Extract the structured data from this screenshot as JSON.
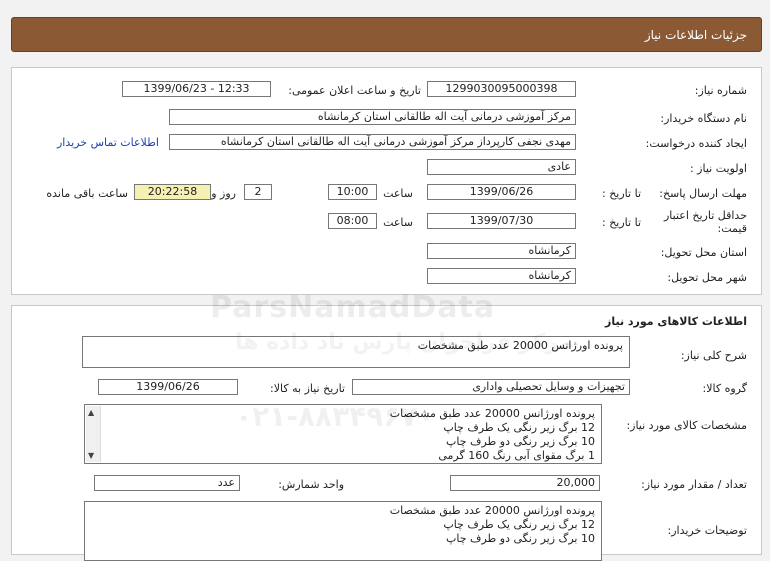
{
  "header": {
    "title": "جزئیات اطلاعات نیاز"
  },
  "form": {
    "need_number_label": "شماره نیاز:",
    "need_number": "1299030095000398",
    "announce_label": "تاریخ و ساعت اعلان عمومی:",
    "announce_value": "1399/06/23 - 12:33",
    "buyer_label": "نام دستگاه خریدار:",
    "buyer_value": "مرکز آموزشی درمانی آیت اله طالقانی استان کرمانشاه",
    "creator_label": "ایجاد کننده درخواست:",
    "creator_value": "مهدی نجفی کارپرداز مرکز آموزشی درمانی آیت اله طالقانی استان کرمانشاه",
    "contact_link": "اطلاعات تماس خریدار",
    "priority_label": "اولویت نیاز :",
    "priority_value": "عادی",
    "deadline_label": "مهلت ارسال پاسخ:",
    "to_date_label": "تا تاریخ :",
    "deadline_date": "1399/06/26",
    "time_label": "ساعت",
    "deadline_time": "10:00",
    "days_value": "2",
    "days_label": "روز و",
    "remaining_value": "20:22:58",
    "remaining_label": "ساعت باقی مانده",
    "validity_label_line1": "حداقل تاریخ اعتبار",
    "validity_label_line2": "قیمت:",
    "validity_to_label": "تا تاریخ :",
    "validity_date": "1399/07/30",
    "validity_time_label": "ساعت",
    "validity_time": "08:00",
    "province_label": "استان محل تحویل:",
    "province_value": "کرمانشاه",
    "city_label": "شهر محل تحویل:",
    "city_value": "کرمانشاه"
  },
  "goods": {
    "section_title": "اطلاعات کالاهای مورد نیاز",
    "summary_label": "شرح کلی نیاز:",
    "summary_value": "پرونده اورژانس 20000 عدد طبق مشخصات",
    "group_label": "گروه کالا:",
    "group_value": "تجهیزات و وسایل تحصیلی واداری",
    "need_date_label": "تاریخ نیاز به کالا:",
    "need_date_value": "1399/06/26",
    "specs_label": "مشخصات کالای مورد نیاز:",
    "specs_lines": [
      "پرونده اورژانس 20000 عدد طبق مشخصات",
      "12 برگ زیر رنگی یک طرف چاپ",
      "10 برگ زیر رنگی دو طرف چاپ",
      "1 برگ مقوای آبی رنگ 160 گرمی"
    ],
    "qty_label": "تعداد / مقدار مورد نیاز:",
    "qty_value": "20,000",
    "unit_label": "واحد شمارش:",
    "unit_value": "عدد",
    "buyer_notes_label": "توضیحات خریدار:",
    "notes_lines": [
      "پرونده اورژانس 20000 عدد طبق مشخصات",
      "12 برگ زیر رنگی یک طرف چاپ",
      "10 برگ زیر رنگی دو طرف چاپ"
    ]
  },
  "watermark": {
    "brand": "ParsNamadData",
    "slogan": "مرکز فراخوان پارس ناد داده ها",
    "phone": "۰۲۱-۸۸۳۴۹۶۷۰"
  },
  "icons": {
    "scroll_up": "triangle-up",
    "scroll_down": "triangle-down"
  }
}
